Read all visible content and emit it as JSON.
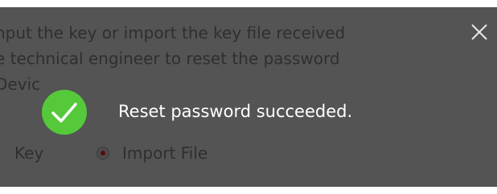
{
  "dialog": {
    "description_lines": [
      "nput the key or import the key file received",
      "e technical engineer to reset the password",
      "Devic"
    ],
    "close_icon": "close-icon"
  },
  "options": {
    "key_label": "Key",
    "import_file_label": "Import File",
    "selected": "Import File"
  },
  "toast": {
    "icon": "success-check-icon",
    "message": "Reset password succeeded.",
    "color": "#55c93a"
  },
  "colors": {
    "overlay": "#545454",
    "dimmed_text": "#2f2f2f",
    "toast_text": "#ffffff"
  }
}
